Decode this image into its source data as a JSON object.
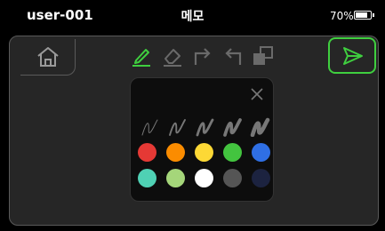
{
  "statusbar": {
    "user": "user-001",
    "title": "메모",
    "battery": "70%",
    "battery_level": 0.7
  },
  "toolbar": {
    "tools": [
      {
        "name": "pen-icon",
        "active": true,
        "color": "#3fcf3f"
      },
      {
        "name": "eraser-icon",
        "active": false
      },
      {
        "name": "redo-icon",
        "active": false
      },
      {
        "name": "undo-icon",
        "active": false
      },
      {
        "name": "layers-icon",
        "active": false
      }
    ]
  },
  "palette": {
    "pen_sizes": 5,
    "colors": [
      "#e53935",
      "#fb8c00",
      "#fdd835",
      "#43c43f",
      "#2f6fe4",
      "#4fd1b4",
      "#a5d67a",
      "#ffffff",
      "#555555",
      "#1c2340"
    ]
  },
  "accent": "#3fcf3f"
}
